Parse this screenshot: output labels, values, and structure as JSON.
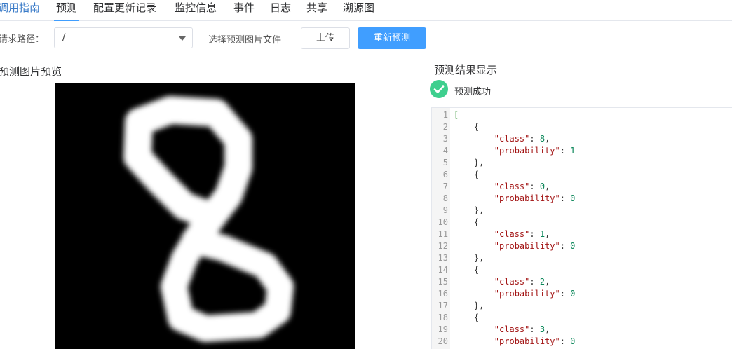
{
  "tabs": [
    {
      "label": "调用指南"
    },
    {
      "label": "预测"
    },
    {
      "label": "配置更新记录"
    },
    {
      "label": "监控信息"
    },
    {
      "label": "事件"
    },
    {
      "label": "日志"
    },
    {
      "label": "共享"
    },
    {
      "label": "溯源图"
    }
  ],
  "active_tab": "预测",
  "request": {
    "path_label": "请求路径：",
    "path_value": "/",
    "file_label": "选择预测图片文件",
    "upload_label": "上传",
    "repredict_label": "重新预测"
  },
  "preview": {
    "title": "预测图片预览",
    "image_desc": "handwritten-digit-8-icon"
  },
  "result": {
    "title": "预测结果显示",
    "status": "预测成功",
    "status_icon": "check-circle-icon",
    "status_color": "#3ecf8e",
    "predictions": [
      {
        "class": 8,
        "probability": 1
      },
      {
        "class": 0,
        "probability": 0
      },
      {
        "class": 1,
        "probability": 0
      },
      {
        "class": 2,
        "probability": 0
      },
      {
        "class": 3,
        "probability": 0
      }
    ]
  },
  "colors": {
    "accent": "#409eff",
    "link": "#3a7bc8"
  }
}
